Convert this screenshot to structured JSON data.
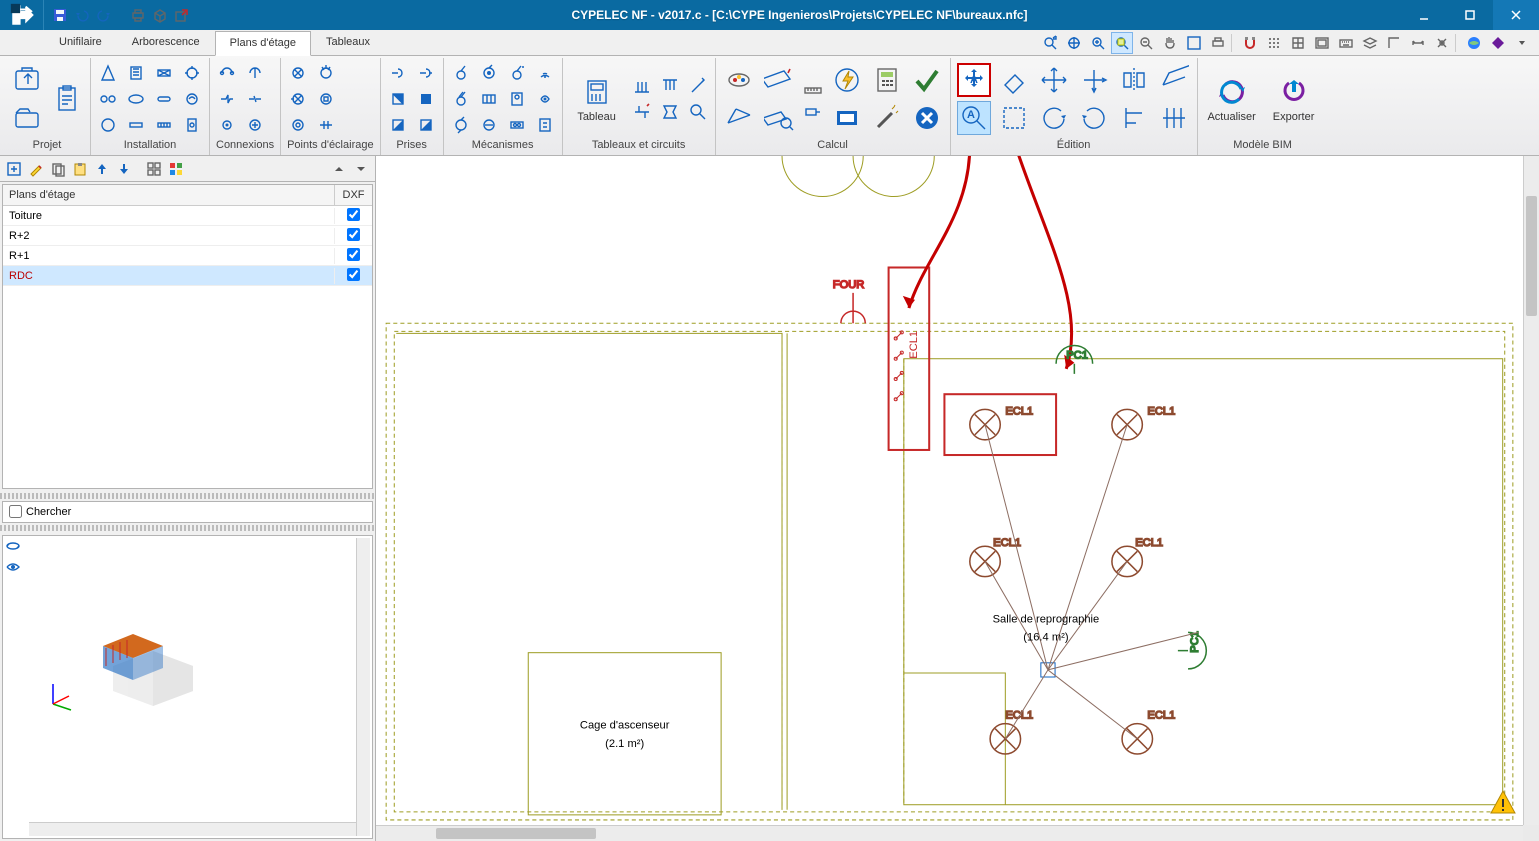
{
  "app": {
    "title": "CYPELEC NF - v2017.c - [C:\\CYPE Ingenieros\\Projets\\CYPELEC NF\\bureaux.nfc]"
  },
  "main_tabs": {
    "items": [
      "Unifilaire",
      "Arborescence",
      "Plans d'étage",
      "Tableaux"
    ],
    "active_index": 2
  },
  "ribbon": {
    "groups": [
      {
        "label": "Projet"
      },
      {
        "label": "Installation"
      },
      {
        "label": "Connexions"
      },
      {
        "label": "Points d'éclairage"
      },
      {
        "label": "Prises"
      },
      {
        "label": "Mécanismes"
      },
      {
        "label": "Tableaux et circuits",
        "tableau_label": "Tableau"
      },
      {
        "label": "Calcul"
      },
      {
        "label": "Édition"
      },
      {
        "label": "Modèle BIM",
        "actualiser": "Actualiser",
        "exporter": "Exporter"
      }
    ]
  },
  "side": {
    "header_name": "Plans d'étage",
    "header_dxf": "DXF",
    "rows": [
      {
        "name": "Toiture",
        "dxf": true,
        "selected": false
      },
      {
        "name": "R+2",
        "dxf": true,
        "selected": false
      },
      {
        "name": "R+1",
        "dxf": true,
        "selected": false
      },
      {
        "name": "RDC",
        "dxf": true,
        "selected": true
      }
    ],
    "search_label": "Chercher"
  },
  "canvas": {
    "labels": {
      "four": "FOUR",
      "ecl1_box_v": "ECL1",
      "pc1_top": "PC1",
      "pc1_side": "PC1",
      "ecl": "ECL1",
      "room1_name": "Salle de reprographie",
      "room1_area": "(16.4 m²)",
      "room2_name": "Cage d'ascenseur",
      "room2_area": "(2.1 m²)"
    }
  }
}
